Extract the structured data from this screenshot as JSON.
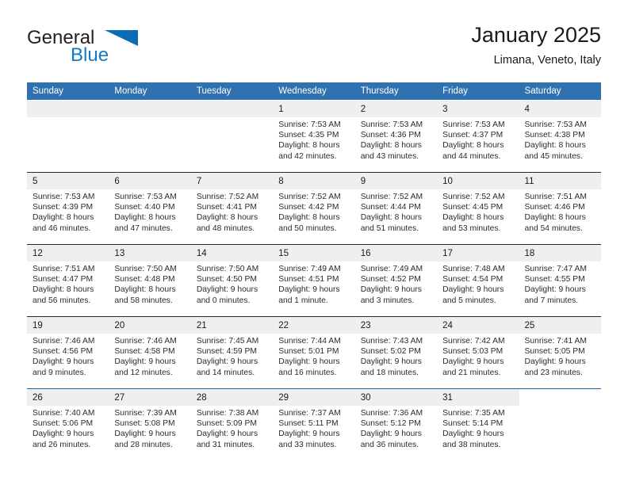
{
  "brand": {
    "name_part1": "General",
    "name_part2": "Blue",
    "logo_icon": "triangle-flag-icon"
  },
  "header": {
    "month_title": "January 2025",
    "location": "Limana, Veneto, Italy"
  },
  "calendar": {
    "weekday_headers": [
      "Sunday",
      "Monday",
      "Tuesday",
      "Wednesday",
      "Thursday",
      "Friday",
      "Saturday"
    ],
    "accent_color": "#3072b0",
    "daynum_band_color": "#efefef",
    "weeks": [
      [
        {
          "day": "",
          "blank": true,
          "lines": []
        },
        {
          "day": "",
          "blank": true,
          "lines": []
        },
        {
          "day": "",
          "blank": true,
          "lines": []
        },
        {
          "day": "1",
          "blank": false,
          "lines": [
            "Sunrise: 7:53 AM",
            "Sunset: 4:35 PM",
            "Daylight: 8 hours",
            "and 42 minutes."
          ]
        },
        {
          "day": "2",
          "blank": false,
          "lines": [
            "Sunrise: 7:53 AM",
            "Sunset: 4:36 PM",
            "Daylight: 8 hours",
            "and 43 minutes."
          ]
        },
        {
          "day": "3",
          "blank": false,
          "lines": [
            "Sunrise: 7:53 AM",
            "Sunset: 4:37 PM",
            "Daylight: 8 hours",
            "and 44 minutes."
          ]
        },
        {
          "day": "4",
          "blank": false,
          "lines": [
            "Sunrise: 7:53 AM",
            "Sunset: 4:38 PM",
            "Daylight: 8 hours",
            "and 45 minutes."
          ]
        }
      ],
      [
        {
          "day": "5",
          "blank": false,
          "lines": [
            "Sunrise: 7:53 AM",
            "Sunset: 4:39 PM",
            "Daylight: 8 hours",
            "and 46 minutes."
          ]
        },
        {
          "day": "6",
          "blank": false,
          "lines": [
            "Sunrise: 7:53 AM",
            "Sunset: 4:40 PM",
            "Daylight: 8 hours",
            "and 47 minutes."
          ]
        },
        {
          "day": "7",
          "blank": false,
          "lines": [
            "Sunrise: 7:52 AM",
            "Sunset: 4:41 PM",
            "Daylight: 8 hours",
            "and 48 minutes."
          ]
        },
        {
          "day": "8",
          "blank": false,
          "lines": [
            "Sunrise: 7:52 AM",
            "Sunset: 4:42 PM",
            "Daylight: 8 hours",
            "and 50 minutes."
          ]
        },
        {
          "day": "9",
          "blank": false,
          "lines": [
            "Sunrise: 7:52 AM",
            "Sunset: 4:44 PM",
            "Daylight: 8 hours",
            "and 51 minutes."
          ]
        },
        {
          "day": "10",
          "blank": false,
          "lines": [
            "Sunrise: 7:52 AM",
            "Sunset: 4:45 PM",
            "Daylight: 8 hours",
            "and 53 minutes."
          ]
        },
        {
          "day": "11",
          "blank": false,
          "lines": [
            "Sunrise: 7:51 AM",
            "Sunset: 4:46 PM",
            "Daylight: 8 hours",
            "and 54 minutes."
          ]
        }
      ],
      [
        {
          "day": "12",
          "blank": false,
          "lines": [
            "Sunrise: 7:51 AM",
            "Sunset: 4:47 PM",
            "Daylight: 8 hours",
            "and 56 minutes."
          ]
        },
        {
          "day": "13",
          "blank": false,
          "lines": [
            "Sunrise: 7:50 AM",
            "Sunset: 4:48 PM",
            "Daylight: 8 hours",
            "and 58 minutes."
          ]
        },
        {
          "day": "14",
          "blank": false,
          "lines": [
            "Sunrise: 7:50 AM",
            "Sunset: 4:50 PM",
            "Daylight: 9 hours",
            "and 0 minutes."
          ]
        },
        {
          "day": "15",
          "blank": false,
          "lines": [
            "Sunrise: 7:49 AM",
            "Sunset: 4:51 PM",
            "Daylight: 9 hours",
            "and 1 minute."
          ]
        },
        {
          "day": "16",
          "blank": false,
          "lines": [
            "Sunrise: 7:49 AM",
            "Sunset: 4:52 PM",
            "Daylight: 9 hours",
            "and 3 minutes."
          ]
        },
        {
          "day": "17",
          "blank": false,
          "lines": [
            "Sunrise: 7:48 AM",
            "Sunset: 4:54 PM",
            "Daylight: 9 hours",
            "and 5 minutes."
          ]
        },
        {
          "day": "18",
          "blank": false,
          "lines": [
            "Sunrise: 7:47 AM",
            "Sunset: 4:55 PM",
            "Daylight: 9 hours",
            "and 7 minutes."
          ]
        }
      ],
      [
        {
          "day": "19",
          "blank": false,
          "lines": [
            "Sunrise: 7:46 AM",
            "Sunset: 4:56 PM",
            "Daylight: 9 hours",
            "and 9 minutes."
          ]
        },
        {
          "day": "20",
          "blank": false,
          "lines": [
            "Sunrise: 7:46 AM",
            "Sunset: 4:58 PM",
            "Daylight: 9 hours",
            "and 12 minutes."
          ]
        },
        {
          "day": "21",
          "blank": false,
          "lines": [
            "Sunrise: 7:45 AM",
            "Sunset: 4:59 PM",
            "Daylight: 9 hours",
            "and 14 minutes."
          ]
        },
        {
          "day": "22",
          "blank": false,
          "lines": [
            "Sunrise: 7:44 AM",
            "Sunset: 5:01 PM",
            "Daylight: 9 hours",
            "and 16 minutes."
          ]
        },
        {
          "day": "23",
          "blank": false,
          "lines": [
            "Sunrise: 7:43 AM",
            "Sunset: 5:02 PM",
            "Daylight: 9 hours",
            "and 18 minutes."
          ]
        },
        {
          "day": "24",
          "blank": false,
          "lines": [
            "Sunrise: 7:42 AM",
            "Sunset: 5:03 PM",
            "Daylight: 9 hours",
            "and 21 minutes."
          ]
        },
        {
          "day": "25",
          "blank": false,
          "lines": [
            "Sunrise: 7:41 AM",
            "Sunset: 5:05 PM",
            "Daylight: 9 hours",
            "and 23 minutes."
          ]
        }
      ],
      [
        {
          "day": "26",
          "blank": false,
          "lines": [
            "Sunrise: 7:40 AM",
            "Sunset: 5:06 PM",
            "Daylight: 9 hours",
            "and 26 minutes."
          ]
        },
        {
          "day": "27",
          "blank": false,
          "lines": [
            "Sunrise: 7:39 AM",
            "Sunset: 5:08 PM",
            "Daylight: 9 hours",
            "and 28 minutes."
          ]
        },
        {
          "day": "28",
          "blank": false,
          "lines": [
            "Sunrise: 7:38 AM",
            "Sunset: 5:09 PM",
            "Daylight: 9 hours",
            "and 31 minutes."
          ]
        },
        {
          "day": "29",
          "blank": false,
          "lines": [
            "Sunrise: 7:37 AM",
            "Sunset: 5:11 PM",
            "Daylight: 9 hours",
            "and 33 minutes."
          ]
        },
        {
          "day": "30",
          "blank": false,
          "lines": [
            "Sunrise: 7:36 AM",
            "Sunset: 5:12 PM",
            "Daylight: 9 hours",
            "and 36 minutes."
          ]
        },
        {
          "day": "31",
          "blank": false,
          "lines": [
            "Sunrise: 7:35 AM",
            "Sunset: 5:14 PM",
            "Daylight: 9 hours",
            "and 38 minutes."
          ]
        },
        {
          "day": "",
          "blank": true,
          "lines": []
        }
      ]
    ]
  }
}
